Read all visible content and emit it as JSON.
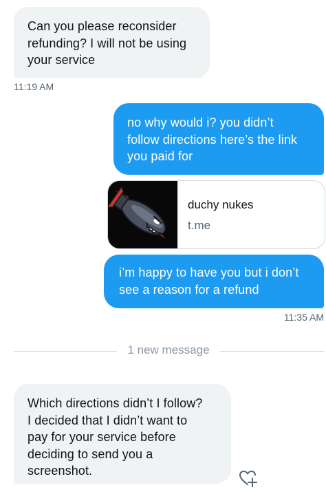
{
  "messages": [
    {
      "id": "m1",
      "direction": "incoming",
      "text": "Can you please reconsider\nrefunding? I will not be using\nyour service",
      "time": "11:19 AM"
    },
    {
      "id": "m2",
      "direction": "outgoing",
      "text": "no why would i? you didn’t\nfollow directions here’s the link\nyou paid for"
    },
    {
      "id": "m3",
      "direction": "outgoing",
      "type": "link_card",
      "title": "duchy nukes",
      "domain": "t.me",
      "thumbnail_icon": "bomb-shark-icon"
    },
    {
      "id": "m4",
      "direction": "outgoing",
      "text": "i’m happy to have you but i don’t\nsee a reason for a refund",
      "time": "11:35 AM"
    },
    {
      "id": "m5",
      "direction": "incoming",
      "text": "Which directions didn’t I follow?\nI decided that I didn’t want to\npay for your service before\ndeciding to send you a\nscreenshot."
    }
  ],
  "divider": {
    "label": "1 new message"
  },
  "icons": {
    "reaction": "add-reaction-heart-icon"
  },
  "colors": {
    "outgoing_bubble": "#1d9bf0",
    "incoming_bubble": "#eff3f4",
    "timestamp": "#536471",
    "divider_text": "#8b98a5"
  }
}
